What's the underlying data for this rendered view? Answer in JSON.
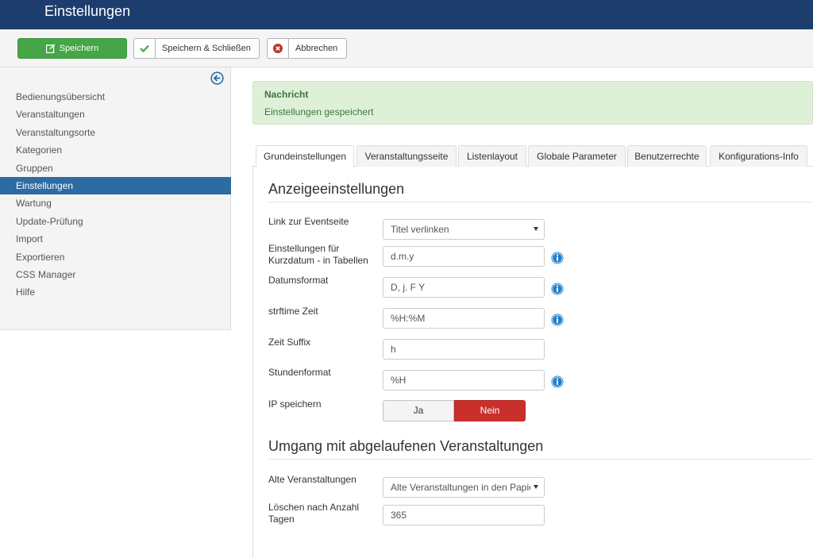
{
  "header": {
    "title": "Einstellungen"
  },
  "toolbar": {
    "save_label": "Speichern",
    "save_close_label": "Speichern & Schließen",
    "cancel_label": "Abbrechen"
  },
  "sidebar": {
    "items": [
      {
        "label": "Bedienungsübersicht"
      },
      {
        "label": "Veranstaltungen"
      },
      {
        "label": "Veranstaltungsorte"
      },
      {
        "label": "Kategorien"
      },
      {
        "label": "Gruppen"
      },
      {
        "label": "Einstellungen"
      },
      {
        "label": "Wartung"
      },
      {
        "label": "Update-Prüfung"
      },
      {
        "label": "Import"
      },
      {
        "label": "Exportieren"
      },
      {
        "label": "CSS Manager"
      },
      {
        "label": "Hilfe"
      }
    ],
    "active_item": "Einstellungen"
  },
  "alert": {
    "title": "Nachricht",
    "message": "Einstellungen gespeichert"
  },
  "tabs": [
    {
      "label": "Grundeinstellungen"
    },
    {
      "label": "Veranstaltungsseite"
    },
    {
      "label": "Listenlayout"
    },
    {
      "label": "Globale Parameter"
    },
    {
      "label": "Benutzerrechte"
    },
    {
      "label": "Konfigurations-Info"
    }
  ],
  "active_tab": "Grundeinstellungen",
  "display_settings": {
    "title": "Anzeigeeinstellungen",
    "link_label": "Link zur Eventseite",
    "link_value": "Titel verlinken",
    "short_date_label": "Einstellungen für Kurzdatum - in Tabellen",
    "short_date_value": "d.m.y",
    "date_format_label": "Datumsformat",
    "date_format_value": "D, j. F Y",
    "strftime_label": "strftime Zeit",
    "strftime_value": "%H:%M",
    "time_suffix_label": "Zeit Suffix",
    "time_suffix_value": "h",
    "hour_format_label": "Stundenformat",
    "hour_format_value": "%H",
    "ip_label": "IP speichern",
    "ip_yes": "Ja",
    "ip_no": "Nein",
    "ip_selected": "Nein"
  },
  "expired_events": {
    "title": "Umgang mit abgelaufenen Veranstaltungen",
    "old_events_label": "Alte Veranstaltungen",
    "old_events_value": "Alte Veranstaltungen in den Papierkorb",
    "delete_after_label": "Löschen nach Anzahl Tagen",
    "delete_after_value": "365"
  },
  "colors": {
    "header_bg": "#1c3d6e",
    "save_button": "#46a546",
    "active_sidebar": "#2d6ca2",
    "alert_bg": "#dff0d8",
    "toggle_no": "#c9302c",
    "info_icon": "#1e7ecb"
  }
}
